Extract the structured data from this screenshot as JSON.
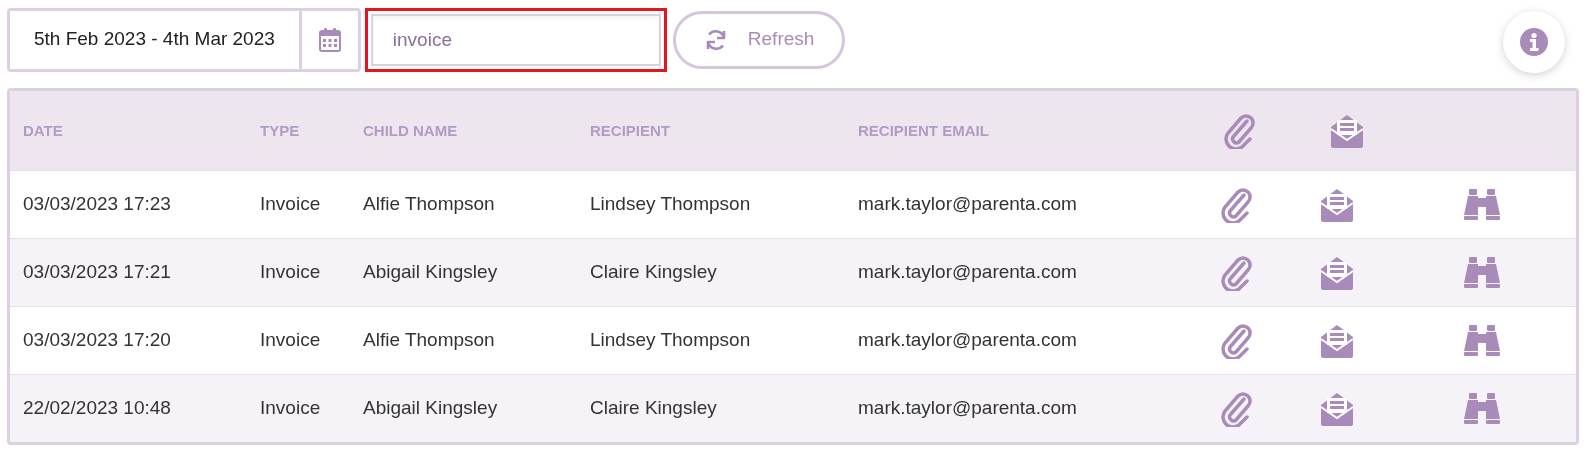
{
  "toolbar": {
    "date_range": "5th Feb 2023 - 4th Mar 2023",
    "search": {
      "value": "invoice",
      "focused": true
    },
    "refresh_button": "Refresh"
  },
  "table": {
    "columns": [
      "DATE",
      "TYPE",
      "CHILD NAME",
      "RECIPIENT",
      "RECIPIENT EMAIL"
    ],
    "rows": [
      {
        "date": "03/03/2023 17:23",
        "type": "Invoice",
        "child_name": "Alfie Thompson",
        "recipient": "Lindsey Thompson",
        "recipient_email": "mark.taylor@parenta.com"
      },
      {
        "date": "03/03/2023 17:21",
        "type": "Invoice",
        "child_name": "Abigail Kingsley",
        "recipient": "Claire Kingsley",
        "recipient_email": "mark.taylor@parenta.com"
      },
      {
        "date": "03/03/2023 17:20",
        "type": "Invoice",
        "child_name": "Alfie Thompson",
        "recipient": "Lindsey Thompson",
        "recipient_email": "mark.taylor@parenta.com"
      },
      {
        "date": "22/02/2023 10:48",
        "type": "Invoice",
        "child_name": "Abigail Kingsley",
        "recipient": "Claire Kingsley",
        "recipient_email": "mark.taylor@parenta.com"
      }
    ]
  }
}
